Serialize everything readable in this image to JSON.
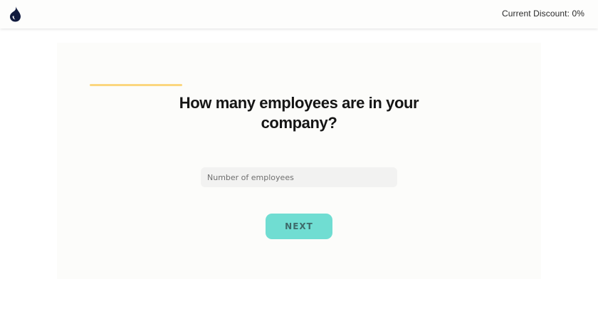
{
  "header": {
    "logo_icon": "droplet-logo-icon",
    "discount_text": "Current Discount: 0%"
  },
  "form": {
    "progress_fraction": 0.19,
    "question": "How many employees are in your company?",
    "employees_input": {
      "value": "",
      "placeholder": "Number of employees"
    },
    "next_label": "NEXT"
  },
  "colors": {
    "accent_teal": "#70ddd2",
    "progress_yellow": "#fbd67e",
    "logo_navy": "#101a3e"
  }
}
